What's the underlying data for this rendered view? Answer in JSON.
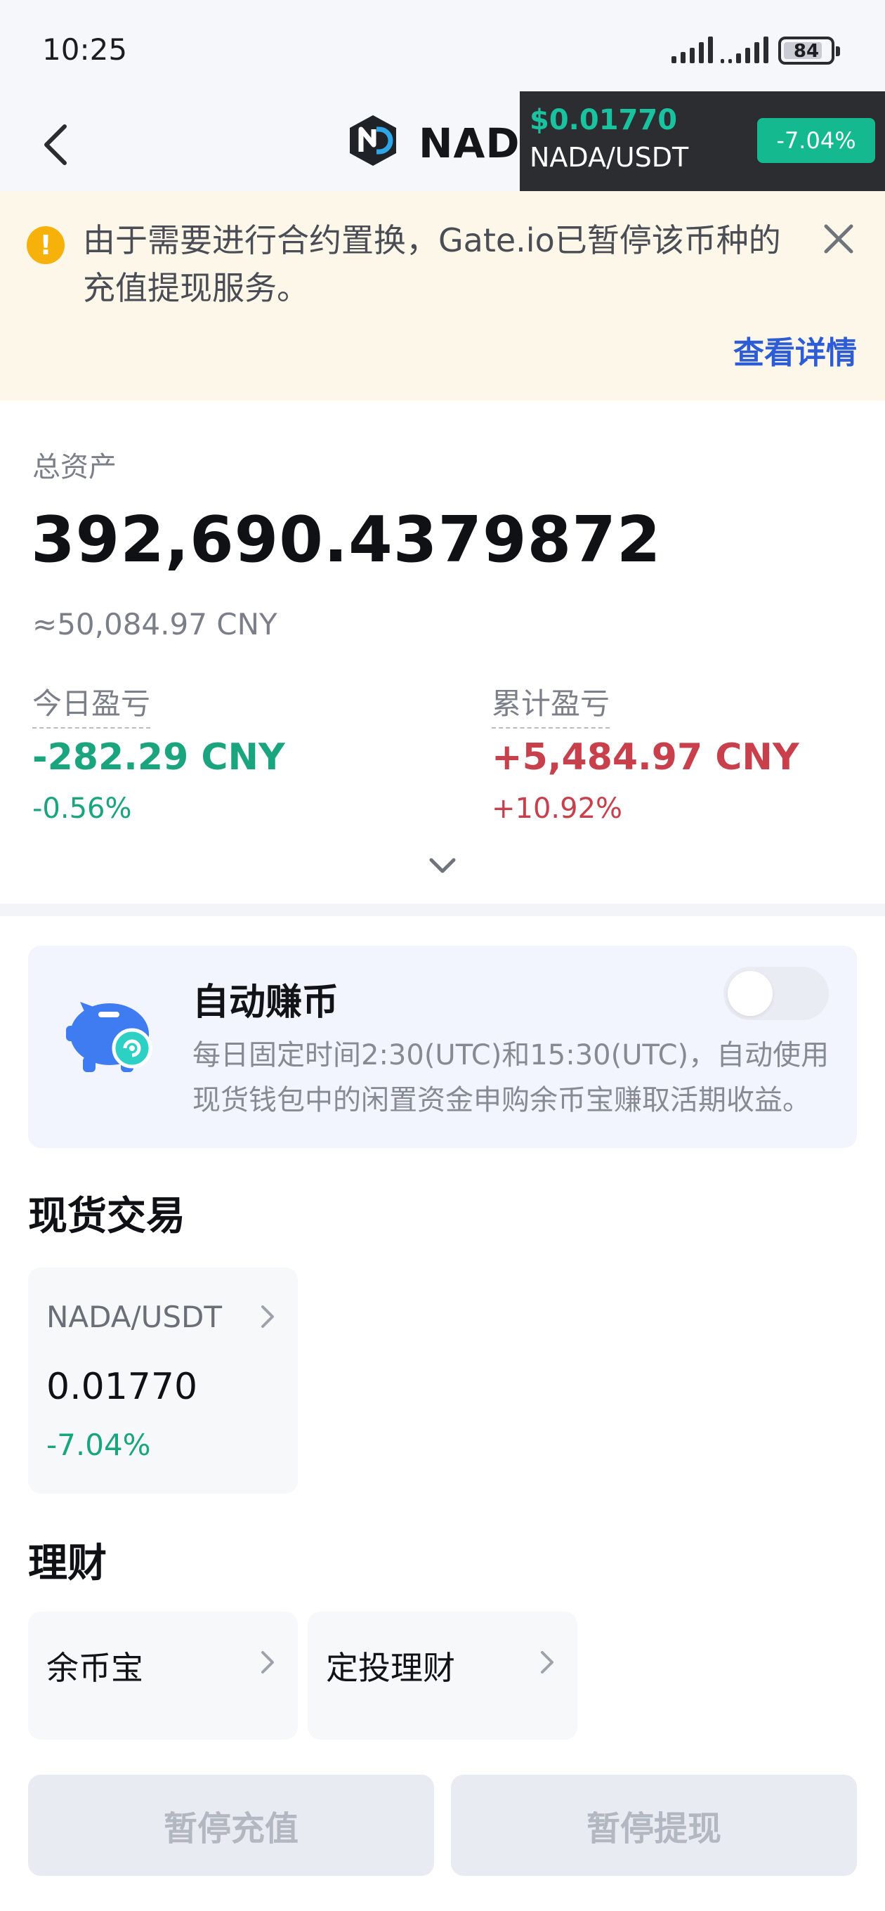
{
  "status_bar": {
    "time": "10:25",
    "battery": "84",
    "battery_level": 0.84
  },
  "header": {
    "coin_name": "NADA",
    "back_icon": "chevron-left-icon",
    "logo_icon": "nada-logo-icon"
  },
  "ticker": {
    "price": "$0.01770",
    "pair": "NADA/USDT",
    "change": "-7.04%"
  },
  "notice": {
    "icon": "warning-icon",
    "text": "由于需要进行合约置换，Gate.io已暂停该币种的充值提现服务。",
    "details_link": "查看详情"
  },
  "assets": {
    "total_label": "总资产",
    "total_value": "392,690.4379872",
    "total_cny": "≈50,084.97 CNY",
    "today_label": "今日盈亏",
    "today_value": "-282.29 CNY",
    "today_pct": "-0.56%",
    "cumulative_label": "累计盈亏",
    "cumulative_value": "+5,484.97 CNY",
    "cumulative_pct": "+10.92%"
  },
  "auto_earn": {
    "title": "自动赚币",
    "description": "每日固定时间2:30(UTC)和15:30(UTC)，自动使用现货钱包中的闲置资金申购余币宝赚取活期收益。",
    "enabled": false
  },
  "spot": {
    "section_title": "现货交易",
    "pair": "NADA/USDT",
    "price": "0.01770",
    "change": "-7.04%"
  },
  "finance": {
    "section_title": "理财",
    "items": [
      {
        "label": "余币宝"
      },
      {
        "label": "定投理财"
      }
    ]
  },
  "actions": {
    "deposit": "暂停充值",
    "withdraw": "暂停提现"
  },
  "colors": {
    "positive": "#c7404c",
    "negative": "#1aa57e",
    "accent_link": "#2c5cd6",
    "ticker_change_bg": "#15b98f"
  }
}
